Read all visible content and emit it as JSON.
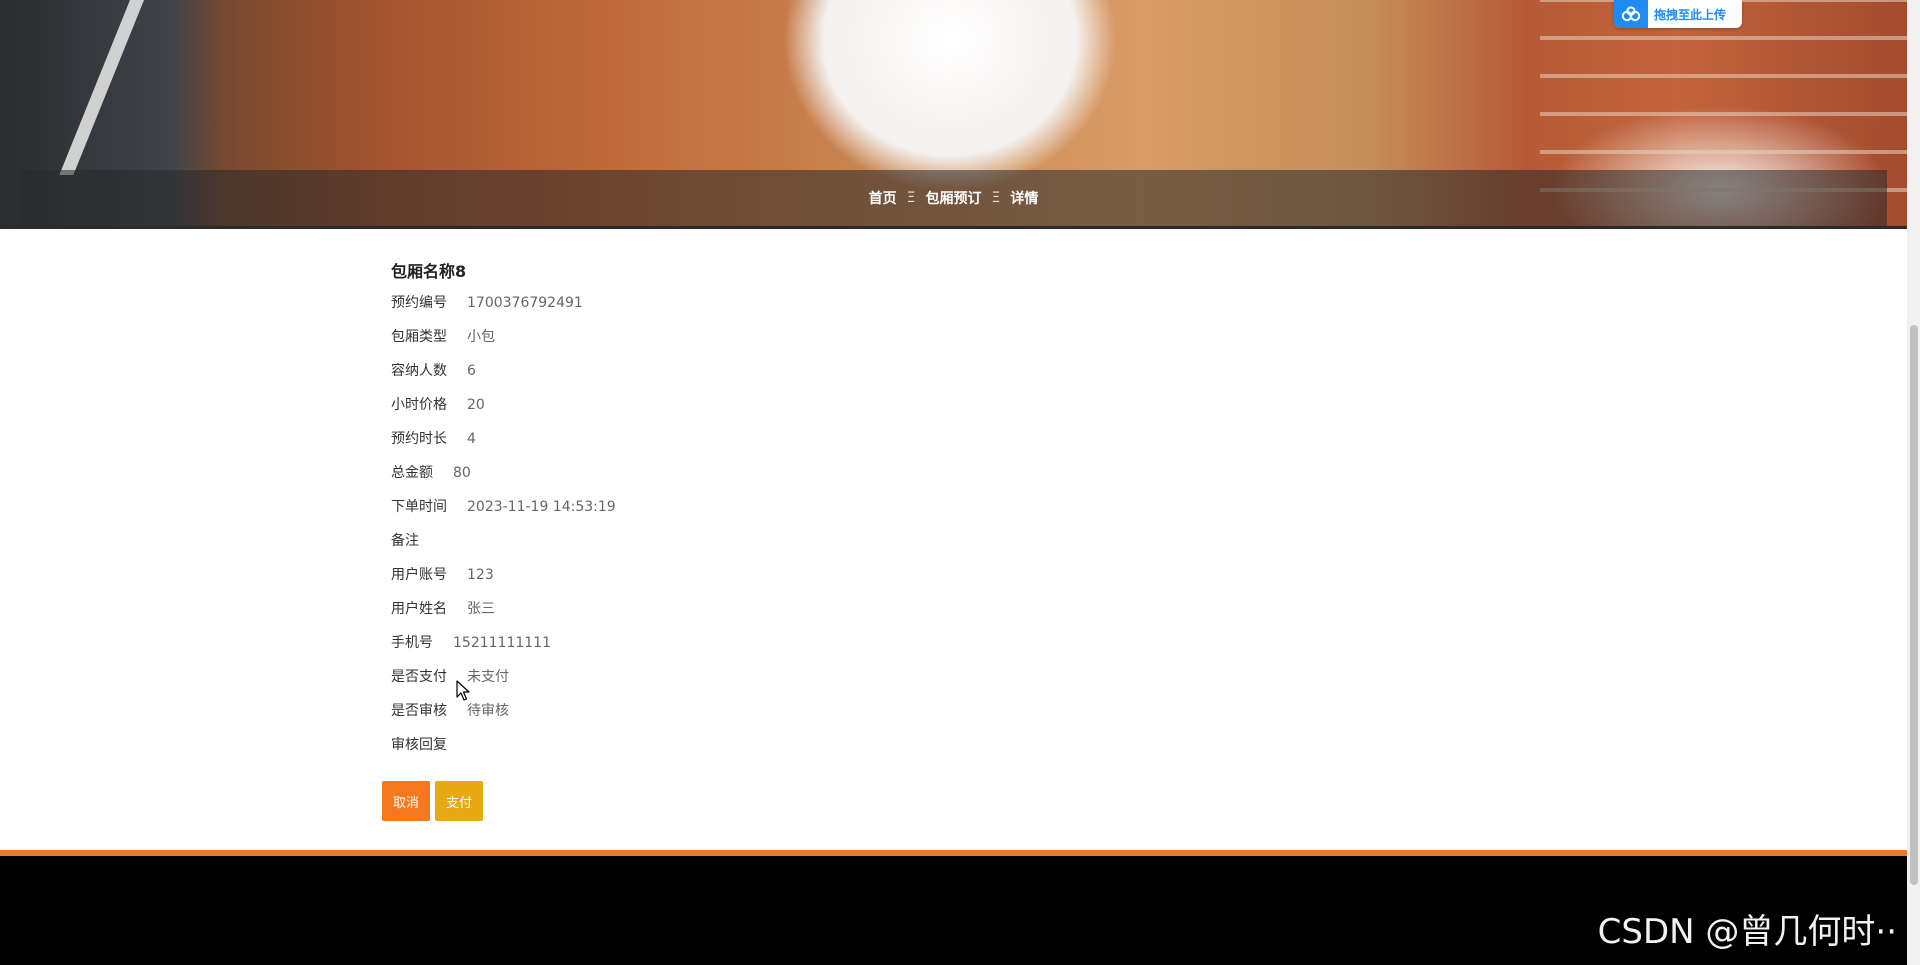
{
  "breadcrumb": {
    "home": "首页",
    "section": "包厢预订",
    "current": "详情",
    "separator": "Ξ"
  },
  "upload_widget": {
    "label": "拖拽至此上传",
    "icon": "cloud-upload-icon"
  },
  "detail": {
    "title": "包厢名称8",
    "fields": [
      {
        "label": "预约编号",
        "value": "1700376792491"
      },
      {
        "label": "包厢类型",
        "value": "小包"
      },
      {
        "label": "容纳人数",
        "value": "6"
      },
      {
        "label": "小时价格",
        "value": "20"
      },
      {
        "label": "预约时长",
        "value": "4"
      },
      {
        "label": "总金额",
        "value": "80"
      },
      {
        "label": "下单时间",
        "value": "2023-11-19 14:53:19"
      },
      {
        "label": "备注",
        "value": ""
      },
      {
        "label": "用户账号",
        "value": "123"
      },
      {
        "label": "用户姓名",
        "value": "张三"
      },
      {
        "label": "手机号",
        "value": "15211111111"
      },
      {
        "label": "是否支付",
        "value": "未支付"
      },
      {
        "label": "是否审核",
        "value": "待审核"
      },
      {
        "label": "审核回复",
        "value": ""
      }
    ]
  },
  "actions": {
    "cancel_label": "取消",
    "pay_label": "支付"
  },
  "colors": {
    "accent_orange": "#f5781e",
    "pay_yellow": "#e8aa14",
    "footer_bg": "#000000"
  },
  "watermark": "CSDN @曾几何时··"
}
